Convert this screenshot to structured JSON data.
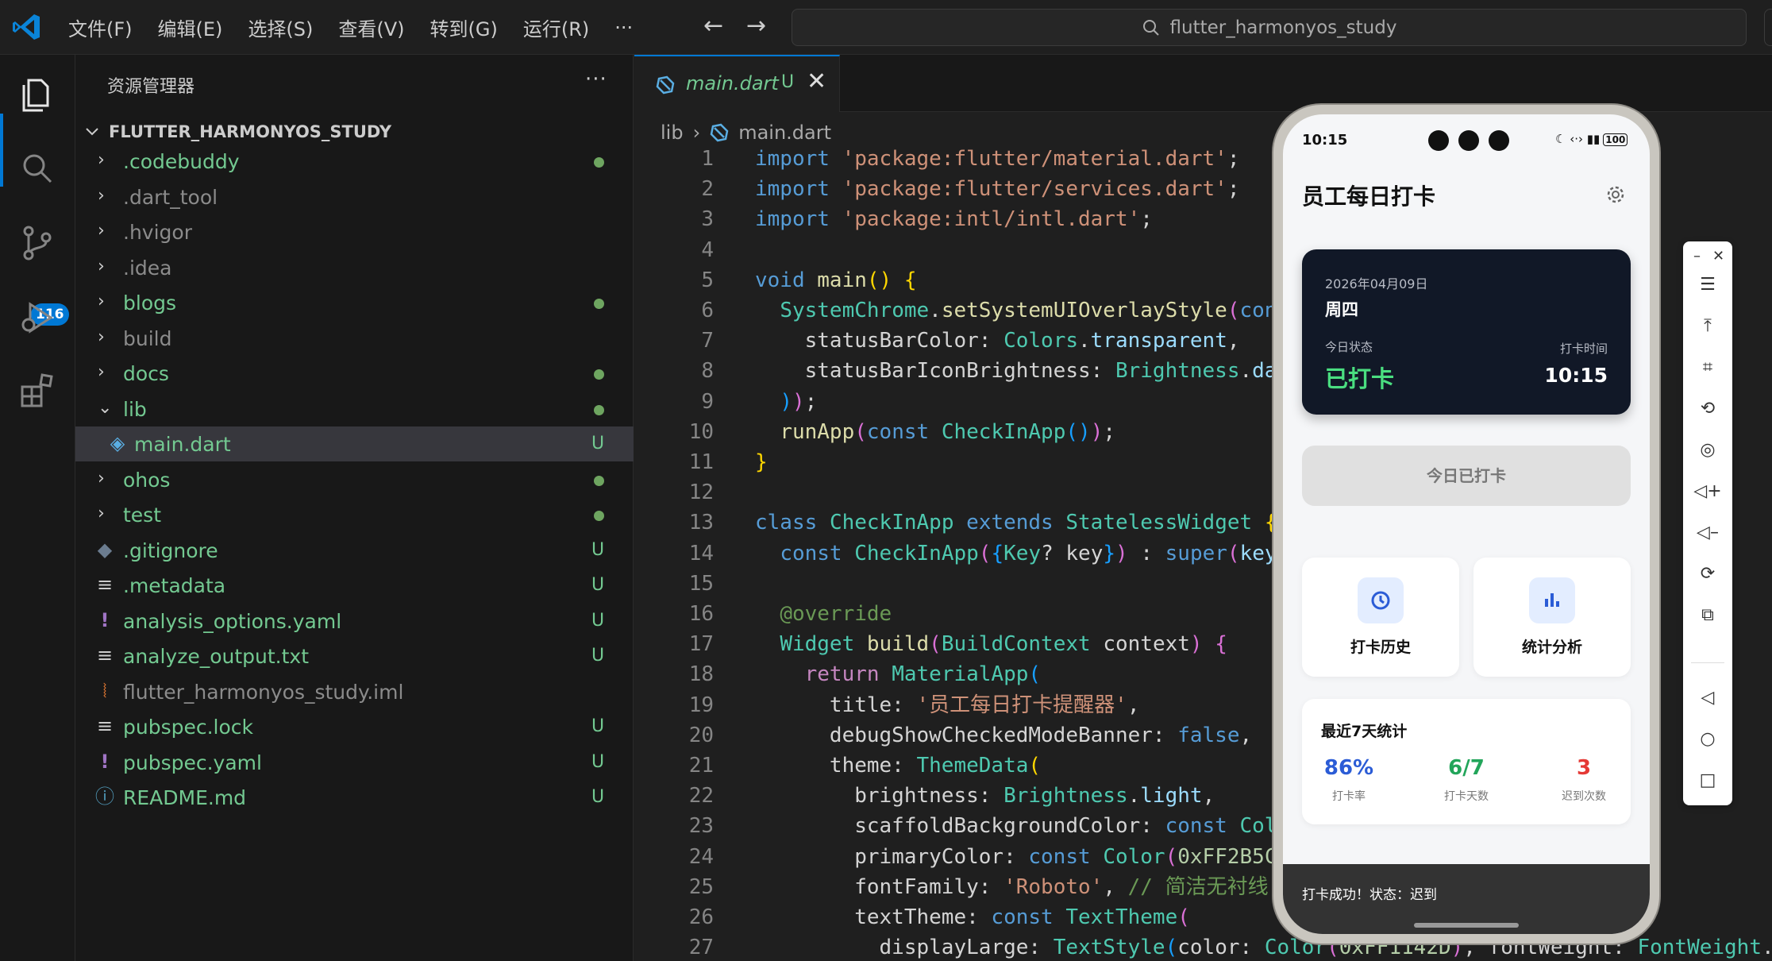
{
  "titlebar": {
    "menu": [
      "文件(F)",
      "编辑(E)",
      "选择(S)",
      "查看(V)",
      "转到(G)",
      "运行(R)",
      "···"
    ],
    "search_text": "flutter_harmonyos_study",
    "back_arrow": "←",
    "forward_arrow": "→"
  },
  "activity": {
    "scm_badge": "116",
    "icons": [
      "explorer-icon",
      "search-icon",
      "source-control-icon",
      "run-debug-icon",
      "extensions-icon"
    ]
  },
  "explorer": {
    "title": "资源管理器",
    "more": "···",
    "project": "FLUTTER_HARMONYOS_STUDY",
    "items": [
      {
        "name": ".codebuddy",
        "kind": "folder",
        "status": "dot"
      },
      {
        "name": ".dart_tool",
        "kind": "folder",
        "status": ""
      },
      {
        "name": ".hvigor",
        "kind": "folder",
        "status": ""
      },
      {
        "name": ".idea",
        "kind": "folder",
        "status": ""
      },
      {
        "name": "blogs",
        "kind": "folder",
        "status": "dot"
      },
      {
        "name": "build",
        "kind": "folder",
        "status": ""
      },
      {
        "name": "docs",
        "kind": "folder",
        "status": "dot"
      },
      {
        "name": "lib",
        "kind": "folder-open",
        "status": "dot"
      },
      {
        "name": "main.dart",
        "kind": "dart",
        "status": "U"
      },
      {
        "name": "ohos",
        "kind": "folder",
        "status": "dot"
      },
      {
        "name": "test",
        "kind": "folder",
        "status": "dot"
      },
      {
        "name": ".gitignore",
        "kind": "git",
        "status": "U"
      },
      {
        "name": ".metadata",
        "kind": "lines",
        "status": "U"
      },
      {
        "name": "analysis_options.yaml",
        "kind": "yaml",
        "status": "U"
      },
      {
        "name": "analyze_output.txt",
        "kind": "lines",
        "status": "U"
      },
      {
        "name": "flutter_harmonyos_study.iml",
        "kind": "rss",
        "status": ""
      },
      {
        "name": "pubspec.lock",
        "kind": "lines",
        "status": "U"
      },
      {
        "name": "pubspec.yaml",
        "kind": "yaml",
        "status": "U"
      },
      {
        "name": "README.md",
        "kind": "info",
        "status": "U"
      }
    ]
  },
  "editor": {
    "tab": {
      "name": "main.dart",
      "status": "U",
      "close": "✕"
    },
    "breadcrumb": [
      "lib",
      "main.dart"
    ],
    "lines": [
      {
        "n": "1",
        "t": [
          [
            "k",
            "import"
          ],
          [
            "w",
            " "
          ],
          [
            "s",
            "'package:flutter/material.dart'"
          ],
          [
            "w",
            ";"
          ]
        ]
      },
      {
        "n": "2",
        "t": [
          [
            "k",
            "import"
          ],
          [
            "w",
            " "
          ],
          [
            "s",
            "'package:flutter/services.dart'"
          ],
          [
            "w",
            ";"
          ]
        ]
      },
      {
        "n": "3",
        "t": [
          [
            "k",
            "import"
          ],
          [
            "w",
            " "
          ],
          [
            "s",
            "'package:intl/intl.dart'"
          ],
          [
            "w",
            ";"
          ]
        ]
      },
      {
        "n": "4",
        "t": []
      },
      {
        "n": "5",
        "t": [
          [
            "k",
            "void"
          ],
          [
            "w",
            " "
          ],
          [
            "f",
            "main"
          ],
          [
            "y",
            "()"
          ],
          [
            "w",
            " "
          ],
          [
            "y",
            "{"
          ]
        ]
      },
      {
        "n": "6",
        "t": [
          [
            "w",
            "  "
          ],
          [
            "t",
            "SystemChrome"
          ],
          [
            "w",
            "."
          ],
          [
            "f",
            "setSystemUIOverlayStyle"
          ],
          [
            "p",
            "("
          ],
          [
            "k",
            "con"
          ]
        ]
      },
      {
        "n": "7",
        "t": [
          [
            "w",
            "    statusBarColor: "
          ],
          [
            "t",
            "Colors"
          ],
          [
            "w",
            "."
          ],
          [
            "v",
            "transparent"
          ],
          [
            "w",
            ","
          ]
        ]
      },
      {
        "n": "8",
        "t": [
          [
            "w",
            "    statusBarIconBrightness: "
          ],
          [
            "t",
            "Brightness"
          ],
          [
            "w",
            "."
          ],
          [
            "v",
            "da"
          ]
        ]
      },
      {
        "n": "9",
        "t": [
          [
            "w",
            "  "
          ],
          [
            "b",
            ")"
          ],
          [
            "p",
            ")"
          ],
          [
            "w",
            ";"
          ]
        ]
      },
      {
        "n": "10",
        "t": [
          [
            "w",
            "  "
          ],
          [
            "f",
            "runApp"
          ],
          [
            "p",
            "("
          ],
          [
            "k",
            "const"
          ],
          [
            "w",
            " "
          ],
          [
            "t",
            "CheckInApp"
          ],
          [
            "b",
            "()"
          ],
          [
            "p",
            ")"
          ],
          [
            "w",
            ";"
          ]
        ]
      },
      {
        "n": "11",
        "t": [
          [
            "y",
            "}"
          ]
        ]
      },
      {
        "n": "12",
        "t": []
      },
      {
        "n": "13",
        "t": [
          [
            "k",
            "class"
          ],
          [
            "w",
            " "
          ],
          [
            "t",
            "CheckInApp"
          ],
          [
            "w",
            " "
          ],
          [
            "k",
            "extends"
          ],
          [
            "w",
            " "
          ],
          [
            "t",
            "StatelessWidget"
          ],
          [
            "w",
            " "
          ],
          [
            "y",
            "{"
          ]
        ]
      },
      {
        "n": "14",
        "t": [
          [
            "w",
            "  "
          ],
          [
            "k",
            "const"
          ],
          [
            "w",
            " "
          ],
          [
            "t",
            "CheckInApp"
          ],
          [
            "p",
            "("
          ],
          [
            "b",
            "{"
          ],
          [
            "t",
            "Key"
          ],
          [
            "w",
            "? key"
          ],
          [
            "b",
            "}"
          ],
          [
            "p",
            ")"
          ],
          [
            "w",
            " : "
          ],
          [
            "k",
            "super"
          ],
          [
            "p",
            "("
          ],
          [
            "v",
            "key"
          ]
        ]
      },
      {
        "n": "15",
        "t": []
      },
      {
        "n": "16",
        "t": [
          [
            "w",
            "  "
          ],
          [
            "c",
            "@override"
          ]
        ]
      },
      {
        "n": "17",
        "t": [
          [
            "w",
            "  "
          ],
          [
            "t",
            "Widget"
          ],
          [
            "w",
            " "
          ],
          [
            "f",
            "build"
          ],
          [
            "p",
            "("
          ],
          [
            "t",
            "BuildContext"
          ],
          [
            "w",
            " context"
          ],
          [
            "p",
            ")"
          ],
          [
            "w",
            " "
          ],
          [
            "p",
            "{"
          ]
        ]
      },
      {
        "n": "18",
        "t": [
          [
            "w",
            "    "
          ],
          [
            "kc",
            "return"
          ],
          [
            "w",
            " "
          ],
          [
            "t",
            "MaterialApp"
          ],
          [
            "b",
            "("
          ]
        ]
      },
      {
        "n": "19",
        "t": [
          [
            "w",
            "      title: "
          ],
          [
            "s",
            "'员工每日打卡提醒器'"
          ],
          [
            "w",
            ","
          ]
        ]
      },
      {
        "n": "20",
        "t": [
          [
            "w",
            "      debugShowCheckedModeBanner: "
          ],
          [
            "k",
            "false"
          ],
          [
            "w",
            ","
          ]
        ]
      },
      {
        "n": "21",
        "t": [
          [
            "w",
            "      theme: "
          ],
          [
            "t",
            "ThemeData"
          ],
          [
            "y",
            "("
          ]
        ]
      },
      {
        "n": "22",
        "t": [
          [
            "w",
            "        brightness: "
          ],
          [
            "t",
            "Brightness"
          ],
          [
            "w",
            "."
          ],
          [
            "v",
            "light"
          ],
          [
            "w",
            ","
          ]
        ]
      },
      {
        "n": "23",
        "t": [
          [
            "w",
            "        scaffoldBackgroundColor: "
          ],
          [
            "k",
            "const"
          ],
          [
            "w",
            " "
          ],
          [
            "t",
            "Col"
          ]
        ]
      },
      {
        "n": "24",
        "t": [
          [
            "w",
            "        primaryColor: "
          ],
          [
            "k",
            "const"
          ],
          [
            "w",
            " "
          ],
          [
            "t",
            "Color"
          ],
          [
            "p",
            "("
          ],
          [
            "n",
            "0xFF2B5C"
          ]
        ]
      },
      {
        "n": "25",
        "t": [
          [
            "w",
            "        fontFamily: "
          ],
          [
            "s",
            "'Roboto'"
          ],
          [
            "w",
            ", "
          ],
          [
            "c",
            "// 简洁无衬线"
          ]
        ]
      },
      {
        "n": "26",
        "t": [
          [
            "w",
            "        textTheme: "
          ],
          [
            "k",
            "const"
          ],
          [
            "w",
            " "
          ],
          [
            "t",
            "TextTheme"
          ],
          [
            "p",
            "("
          ]
        ]
      },
      {
        "n": "27",
        "t": [
          [
            "w",
            "          displayLarge: "
          ],
          [
            "t",
            "TextStyle"
          ],
          [
            "b",
            "("
          ],
          [
            "w",
            "color: "
          ],
          [
            "t",
            "Color"
          ],
          [
            "p",
            "("
          ],
          [
            "n",
            "0xFF1142D"
          ],
          [
            "p",
            ")"
          ],
          [
            "w",
            ", fontWeight: "
          ],
          [
            "t",
            "FontWeight"
          ],
          [
            "w",
            "."
          ]
        ]
      }
    ]
  },
  "phone": {
    "status_time": "10:15",
    "status_icons": "☾ ‹·› ▮▮",
    "battery": "100",
    "title": "员工每日打卡",
    "card": {
      "date": "2026年04月09日",
      "weekday": "周四",
      "status_label": "今日状态",
      "status_value": "已打卡",
      "time_label": "打卡时间",
      "time_value": "10:15"
    },
    "checkin_button": "今日已打卡",
    "actions": [
      {
        "label": "打卡历史",
        "icon": "history-icon"
      },
      {
        "label": "统计分析",
        "icon": "bar-chart-icon"
      }
    ],
    "stats": {
      "title": "最近7天统计",
      "items": [
        {
          "value": "86%",
          "label": "打卡率",
          "color": "#2b5cd6"
        },
        {
          "value": "6/7",
          "label": "打卡天数",
          "color": "#22a55a"
        },
        {
          "value": "3",
          "label": "迟到次数",
          "color": "#e53935"
        }
      ]
    },
    "snackbar": "打卡成功！状态：迟到"
  },
  "emulator_toolbar": {
    "buttons": [
      "minimize-icon",
      "close-icon",
      "menu-icon",
      "pin-top-icon",
      "crop-icon",
      "rotate-icon",
      "screenshot-icon",
      "volume-up-icon",
      "volume-down-icon",
      "shake-icon",
      "multi-window-icon",
      "back-icon",
      "home-icon",
      "recent-apps-icon"
    ]
  },
  "colors": {
    "accent": "#0078d4",
    "untracked": "#73c991",
    "dot": "#6ea560",
    "card_dark": "#111827",
    "success": "#4ade80"
  }
}
